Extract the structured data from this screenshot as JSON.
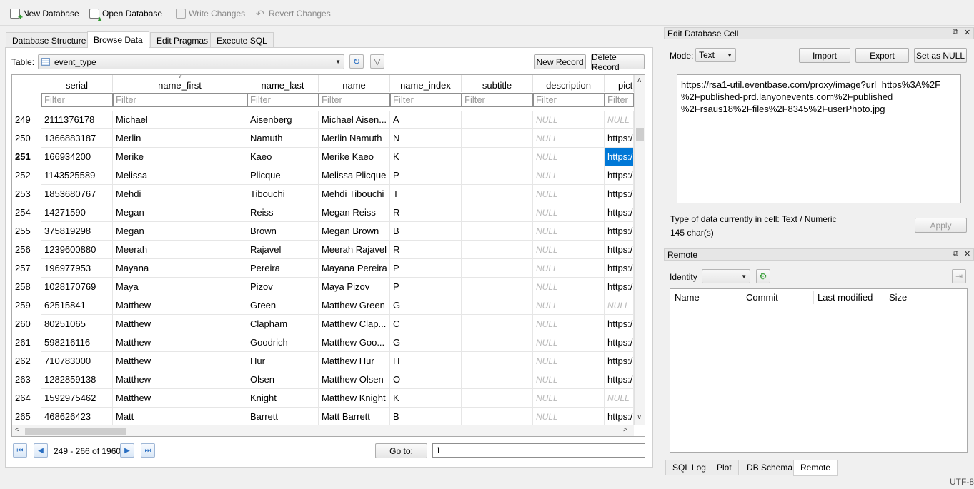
{
  "toolbar": {
    "new_database": "New Database",
    "open_database": "Open Database",
    "write_changes": "Write Changes",
    "revert_changes": "Revert Changes"
  },
  "tabs": [
    "Database Structure",
    "Browse Data",
    "Edit Pragmas",
    "Execute SQL"
  ],
  "active_tab": "Browse Data",
  "browse": {
    "table_label": "Table:",
    "table_name": "event_type",
    "new_record": "New Record",
    "delete_record": "Delete Record",
    "columns": [
      "serial",
      "name_first",
      "name_last",
      "name",
      "name_index",
      "subtitle",
      "description",
      "pict"
    ],
    "filter_placeholder": "Filter",
    "null_text": "NULL",
    "rows": [
      {
        "num": "249",
        "serial": "2111376178",
        "name_first": "Michael",
        "name_last": "Aisenberg",
        "name": "Michael Aisen...",
        "name_index": "A",
        "subtitle": "",
        "description": "NULL",
        "pict": "NULL"
      },
      {
        "num": "250",
        "serial": "1366883187",
        "name_first": "Merlin",
        "name_last": "Namuth",
        "name": "Merlin Namuth",
        "name_index": "N",
        "subtitle": "",
        "description": "NULL",
        "pict": "https:/"
      },
      {
        "num": "251",
        "serial": "166934200",
        "name_first": "Merike",
        "name_last": "Kaeo",
        "name": "Merike Kaeo",
        "name_index": "K",
        "subtitle": "",
        "description": "NULL",
        "pict": "https:/"
      },
      {
        "num": "252",
        "serial": "1143525589",
        "name_first": "Melissa",
        "name_last": "Plicque",
        "name": "Melissa Plicque",
        "name_index": "P",
        "subtitle": "",
        "description": "NULL",
        "pict": "https:/"
      },
      {
        "num": "253",
        "serial": "1853680767",
        "name_first": "Mehdi",
        "name_last": "Tibouchi",
        "name": "Mehdi Tibouchi",
        "name_index": "T",
        "subtitle": "",
        "description": "NULL",
        "pict": "https:/"
      },
      {
        "num": "254",
        "serial": "14271590",
        "name_first": "Megan",
        "name_last": "Reiss",
        "name": "Megan Reiss",
        "name_index": "R",
        "subtitle": "",
        "description": "NULL",
        "pict": "https:/"
      },
      {
        "num": "255",
        "serial": "375819298",
        "name_first": "Megan",
        "name_last": "Brown",
        "name": "Megan Brown",
        "name_index": "B",
        "subtitle": "",
        "description": "NULL",
        "pict": "https:/"
      },
      {
        "num": "256",
        "serial": "1239600880",
        "name_first": "Meerah",
        "name_last": "Rajavel",
        "name": "Meerah Rajavel",
        "name_index": "R",
        "subtitle": "",
        "description": "NULL",
        "pict": "https:/"
      },
      {
        "num": "257",
        "serial": "196977953",
        "name_first": "Mayana",
        "name_last": "Pereira",
        "name": "Mayana Pereira",
        "name_index": "P",
        "subtitle": "",
        "description": "NULL",
        "pict": "https:/"
      },
      {
        "num": "258",
        "serial": "1028170769",
        "name_first": "Maya",
        "name_last": "Pizov",
        "name": "Maya Pizov",
        "name_index": "P",
        "subtitle": "",
        "description": "NULL",
        "pict": "https:/"
      },
      {
        "num": "259",
        "serial": "62515841",
        "name_first": "Matthew",
        "name_last": "Green",
        "name": "Matthew Green",
        "name_index": "G",
        "subtitle": "",
        "description": "NULL",
        "pict": "NULL"
      },
      {
        "num": "260",
        "serial": "80251065",
        "name_first": "Matthew",
        "name_last": "Clapham",
        "name": "Matthew Clap...",
        "name_index": "C",
        "subtitle": "",
        "description": "NULL",
        "pict": "https:/"
      },
      {
        "num": "261",
        "serial": "598216116",
        "name_first": "Matthew",
        "name_last": "Goodrich",
        "name": "Matthew Goo...",
        "name_index": "G",
        "subtitle": "",
        "description": "NULL",
        "pict": "https:/"
      },
      {
        "num": "262",
        "serial": "710783000",
        "name_first": "Matthew",
        "name_last": "Hur",
        "name": "Matthew Hur",
        "name_index": "H",
        "subtitle": "",
        "description": "NULL",
        "pict": "https:/"
      },
      {
        "num": "263",
        "serial": "1282859138",
        "name_first": "Matthew",
        "name_last": "Olsen",
        "name": "Matthew Olsen",
        "name_index": "O",
        "subtitle": "",
        "description": "NULL",
        "pict": "https:/"
      },
      {
        "num": "264",
        "serial": "1592975462",
        "name_first": "Matthew",
        "name_last": "Knight",
        "name": "Matthew Knight",
        "name_index": "K",
        "subtitle": "",
        "description": "NULL",
        "pict": "NULL"
      },
      {
        "num": "265",
        "serial": "468626423",
        "name_first": "Matt",
        "name_last": "Barrett",
        "name": "Matt Barrett",
        "name_index": "B",
        "subtitle": "",
        "description": "NULL",
        "pict": "https:/"
      }
    ],
    "selected_row": "251",
    "selected_column": "pict",
    "record_range": "249 - 266 of 1960",
    "goto_label": "Go to:",
    "goto_value": "1"
  },
  "edit_cell": {
    "title": "Edit Database Cell",
    "mode_label": "Mode:",
    "mode_value": "Text",
    "import": "Import",
    "export": "Export",
    "set_null": "Set as NULL",
    "content_lines": [
      "https://rsa1-util.eventbase.com/proxy/image?url=https%3A%2F",
      "%2Fpublished-prd.lanyonevents.com%2Fpublished",
      "%2Frsaus18%2Ffiles%2F8345%2FuserPhoto.jpg"
    ],
    "type_info": "Type of data currently in cell: Text / Numeric",
    "char_count": "145 char(s)",
    "apply": "Apply"
  },
  "remote": {
    "title": "Remote",
    "identity_label": "Identity",
    "identity_value": "",
    "columns": [
      "Name",
      "Commit",
      "Last modified",
      "Size"
    ]
  },
  "bottom_tabs": [
    "SQL Log",
    "Plot",
    "DB Schema",
    "Remote"
  ],
  "active_bottom_tab": "Remote",
  "status": {
    "encoding": "UTF-8"
  },
  "colors": {
    "selection": "#0078d7",
    "null_text": "#b8b8b8",
    "nav_accent": "#2a6fc2"
  }
}
